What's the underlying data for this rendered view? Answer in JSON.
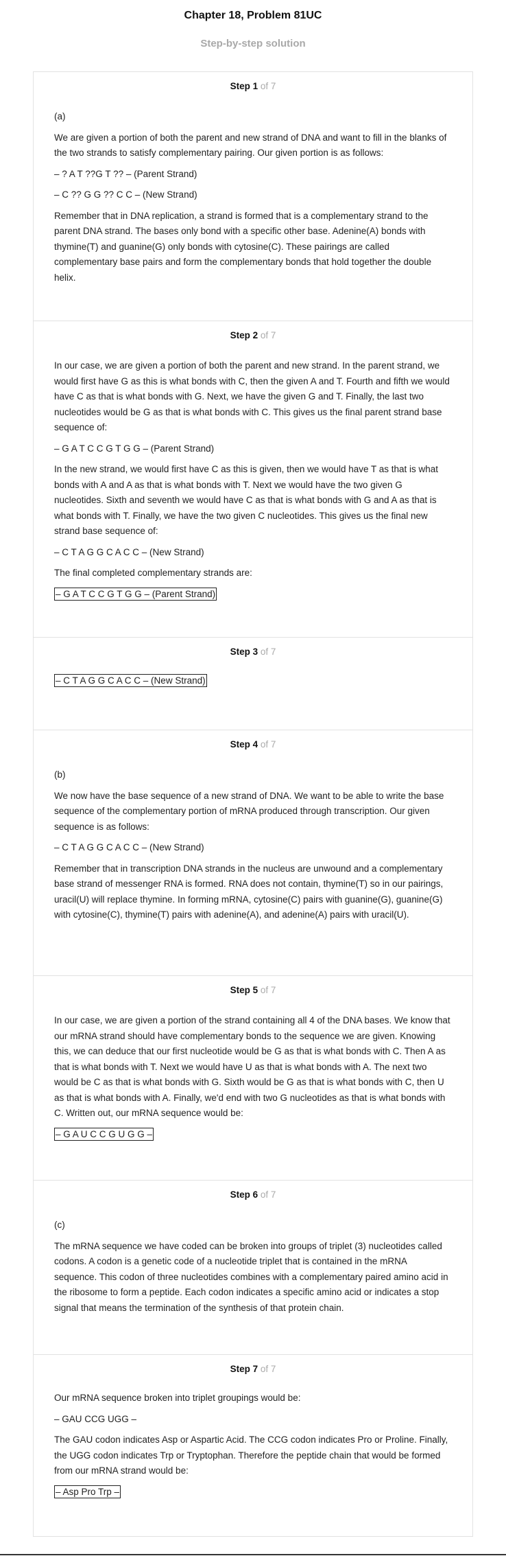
{
  "header": {
    "title": "Chapter 18, Problem 81UC",
    "subtitle": "Step-by-step solution"
  },
  "steps": [
    {
      "label": "Step 1",
      "of": "of 7",
      "part": "(a)",
      "p1": "We are given a portion of both the parent and new strand of DNA and want to fill in the blanks of the two strands to satisfy complementary pairing. Our given portion is as follows:",
      "p2": "– ? A T ??G T ?? – (Parent Strand)",
      "p3": "– C ?? G G ?? C C – (New Strand)",
      "p4": "Remember that in DNA replication, a strand is formed that is a complementary strand to the parent DNA strand. The bases only bond with a specific other base. Adenine(A) bonds with thymine(T) and guanine(G) only bonds with cytosine(C). These pairings are called complementary base pairs and form the complementary bonds that hold together the double helix."
    },
    {
      "label": "Step 2",
      "of": "of 7",
      "p1": "In our case, we are given a portion of both the parent and new strand. In the parent strand, we would first have G as this is what bonds with C, then the given A and T. Fourth and fifth we would have C as that is what bonds with G. Next, we have the given G and T. Finally, the last two nucleotides would be G as that is what bonds with C. This gives us the final parent strand base sequence of:",
      "p2": "– G A T C C G T G G – (Parent Strand)",
      "p3": "In the new strand, we would first have C as this is given, then we would have T as that is what bonds with A and A as that is what bonds with T. Next we would have the two given G nucleotides. Sixth and seventh we would have C as that is what bonds with G and A as that is what bonds with T. Finally, we have the two given C nucleotides. This gives us the final new strand base sequence of:",
      "p4": "– C T A G G C A C C – (New Strand)",
      "p5": "The final completed complementary strands are:",
      "boxed": "– G A T C C G T G G – (Parent Strand)"
    },
    {
      "label": "Step 3",
      "of": "of 7",
      "boxed": "– C T A G G C A C C – (New Strand)"
    },
    {
      "label": "Step 4",
      "of": "of 7",
      "part": "(b)",
      "p1": "We now have the base sequence of a new strand of DNA. We want to be able to write the base sequence of the complementary portion of mRNA produced through transcription. Our given sequence is as follows:",
      "p2": "– C T A G G C A C C – (New Strand)",
      "p3": "Remember that in transcription DNA strands in the nucleus are unwound and a complementary base strand of messenger RNA is formed. RNA does not contain, thymine(T) so in our pairings, uracil(U) will replace thymine. In forming mRNA, cytosine(C) pairs with guanine(G), guanine(G) with cytosine(C), thymine(T) pairs with adenine(A), and adenine(A) pairs with uracil(U)."
    },
    {
      "label": "Step 5",
      "of": "of 7",
      "p1": "In our case, we are given a portion of the strand containing all 4 of the DNA bases. We know that our mRNA strand should have complementary bonds to the sequence we are given. Knowing this, we can deduce that our first nucleotide would be G as that is what bonds with C. Then A as that is what bonds with T. Next we would have U as that is what bonds with A. The next two would be C as that is what bonds with G. Sixth would be G as that is what bonds with C, then U as that is what bonds with A. Finally, we'd end with two G nucleotides as that is what bonds with C. Written out, our mRNA sequence would be:",
      "boxed": "– G A U C C G U G G –"
    },
    {
      "label": "Step 6",
      "of": "of 7",
      "part": "(c)",
      "p1": "The mRNA sequence we have coded can be broken into groups of triplet (3) nucleotides called codons. A codon is a genetic code of a nucleotide triplet that is contained in the mRNA sequence. This codon of three nucleotides combines with a complementary paired amino acid in the ribosome to form a peptide. Each codon indicates a specific amino acid or indicates a stop signal that means the termination of the synthesis of that protein chain."
    },
    {
      "label": "Step 7",
      "of": "of 7",
      "p1": "Our mRNA sequence broken into triplet groupings would be:",
      "p2": "– GAU CCG UGG –",
      "p3": "The GAU codon indicates Asp or Aspartic Acid. The CCG codon indicates Pro or Proline. Finally, the UGG codon indicates Trp or Tryptophan. Therefore the peptide chain that would be formed from our mRNA strand would be:",
      "boxed": "– Asp Pro Trp –"
    }
  ]
}
